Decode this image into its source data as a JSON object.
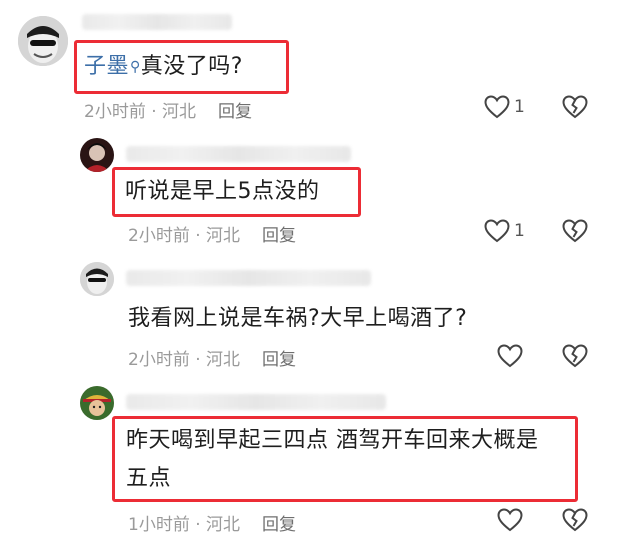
{
  "comments": [
    {
      "mention": "子墨",
      "text": "真没了吗?",
      "time": "2小时前",
      "location": "河北",
      "reply_label": "回复",
      "like_count": "1",
      "highlighted": true
    },
    {
      "text": "听说是早上5点没的",
      "time": "2小时前",
      "location": "河北",
      "reply_label": "回复",
      "like_count": "1",
      "highlighted": true
    },
    {
      "text": "我看网上说是车祸?大早上喝酒了?",
      "time": "2小时前",
      "location": "河北",
      "reply_label": "回复",
      "like_count": "",
      "highlighted": false
    },
    {
      "text_line1": "昨天喝到早起三四点 酒驾开车回来大概是",
      "text_line2": "五点",
      "time": "1小时前",
      "location": "河北",
      "reply_label": "回复",
      "like_count": "",
      "highlighted": true
    }
  ],
  "icons": [
    "heart-icon",
    "broken-heart-icon",
    "search-icon"
  ],
  "colors": {
    "highlight_border": "#ec2c35",
    "mention": "#3d6fa8",
    "meta": "#9a9a9a"
  }
}
